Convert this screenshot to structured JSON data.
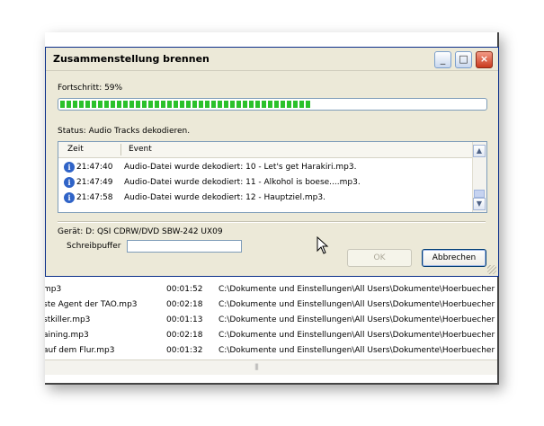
{
  "dialog": {
    "title": "Zusammenstellung brennen",
    "progress_label": "Fortschritt: 59%",
    "progress_value": 0.59,
    "status_label": "Status: Audio Tracks dekodieren.",
    "log_columns": [
      "Zeit",
      "Event"
    ],
    "log_rows": [
      {
        "time": "21:47:40",
        "event": "Audio-Datei wurde dekodiert: 10 - Let's get Harakiri.mp3."
      },
      {
        "time": "21:47:49",
        "event": "Audio-Datei wurde dekodiert: 11 - Alkohol is boese....mp3."
      },
      {
        "time": "21:47:58",
        "event": "Audio-Datei wurde dekodiert: 12 - Hauptziel.mp3."
      }
    ],
    "device_label": "Gerät: D: QSI CDRW/DVD SBW-242 UX09",
    "buffer_label": "Schreibpuffer",
    "ok_label": "OK",
    "cancel_label": "Abbrechen",
    "title_buttons": {
      "minimize": "_",
      "maximize": "□",
      "close": "×"
    }
  },
  "file_list": [
    {
      "name": "mp3",
      "duration": "00:01:52",
      "path": "C:\\Dokumente und Einstellungen\\All Users\\Dokumente\\Hoerbuecher"
    },
    {
      "name": "ste Agent der TAO.mp3",
      "duration": "00:02:18",
      "path": "C:\\Dokumente und Einstellungen\\All Users\\Dokumente\\Hoerbuecher"
    },
    {
      "name": "stkiller.mp3",
      "duration": "00:01:13",
      "path": "C:\\Dokumente und Einstellungen\\All Users\\Dokumente\\Hoerbuecher"
    },
    {
      "name": "aining.mp3",
      "duration": "00:02:18",
      "path": "C:\\Dokumente und Einstellungen\\All Users\\Dokumente\\Hoerbuecher"
    },
    {
      "name": "auf dem Flur.mp3",
      "duration": "00:01:32",
      "path": "C:\\Dokumente und Einstellungen\\All Users\\Dokumente\\Hoerbuecher"
    }
  ],
  "icons": {
    "log_row": "info-icon",
    "pointer": "arrow-cursor-icon"
  },
  "colors": {
    "progress": "#2bc12b",
    "title_close": "#c93a1e",
    "dialog_bg": "#ece9d8"
  }
}
